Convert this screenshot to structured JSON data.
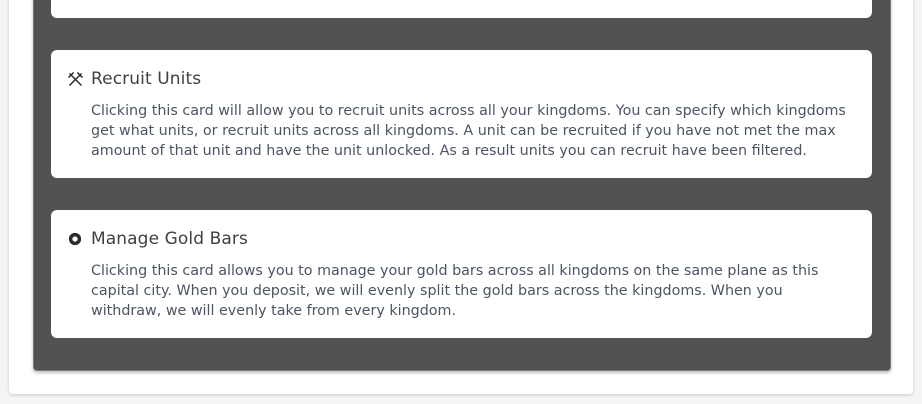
{
  "cards": [
    {
      "icon": "crossed-swords-icon",
      "title": "Recruit Units",
      "description": "Clicking this card will allow you to recruit units across all your kingdoms. You can specify which kingdoms get what units, or recruit units across all kingdoms. A unit can be recruited if you have not met the max amount of that unit and have the unit unlocked. As a result units you can recruit have been filtered."
    },
    {
      "icon": "gold-coin-icon",
      "title": "Manage Gold Bars",
      "description": "Clicking this card allows you to manage your gold bars across all kingdoms on the same plane as this capital city. When you deposit, we will evenly split the gold bars across the kingdoms. When you withdraw, we will evenly take from every kingdom."
    }
  ],
  "colors": {
    "container_bg": "#525252",
    "card_bg": "#ffffff",
    "title_text": "#3f3f46",
    "body_text": "#4b5563"
  }
}
